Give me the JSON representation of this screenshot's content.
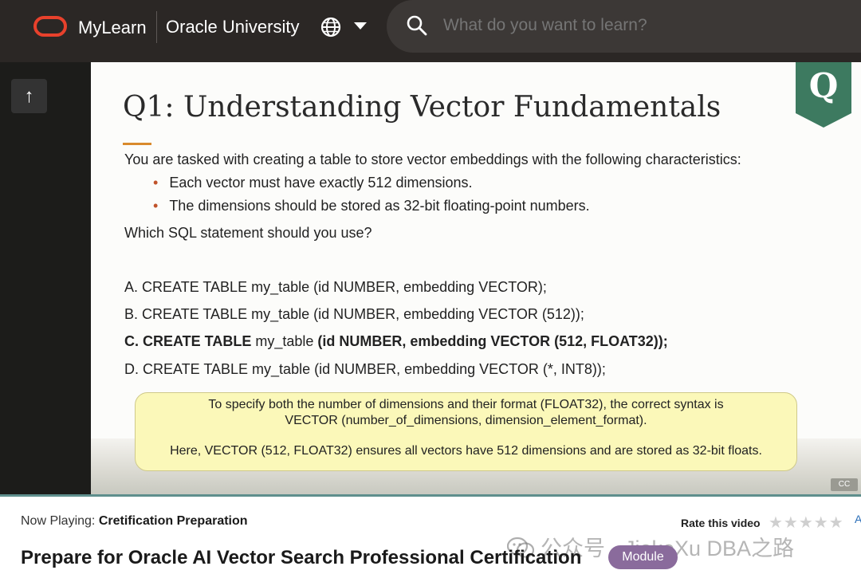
{
  "header": {
    "brand": "MyLearn",
    "org": "Oracle University",
    "search": {
      "placeholder": "What do you want to learn?"
    }
  },
  "rail": {
    "up_label": "↑"
  },
  "slide": {
    "badge": "Q",
    "title": "Q1: Understanding Vector Fundamentals",
    "intro": "You are tasked with creating a table to store vector embeddings with the following characteristics:",
    "bullets": [
      "Each vector must have exactly 512 dimensions.",
      "The dimensions should be stored as 32-bit floating-point numbers."
    ],
    "ask": "Which SQL statement should you use?",
    "options": {
      "a_letter": "A.",
      "a_text": "CREATE TABLE my_table (id NUMBER, embedding VECTOR);",
      "b_letter": "B.",
      "b_text": "CREATE TABLE my_table (id NUMBER, embedding VECTOR (512));",
      "c_letter": "C.",
      "c_part1": "CREATE TABLE",
      "c_part2": "my_table",
      "c_part3": "(id NUMBER, embedding VECTOR (512, FLOAT32));",
      "d_letter": "D.",
      "d_text": "CREATE TABLE my_table (id NUMBER, embedding VECTOR (*, INT8));"
    },
    "explanation": {
      "line1": "To specify both the number of dimensions and their format (FLOAT32), the correct syntax is",
      "line2": "VECTOR (number_of_dimensions, dimension_element_format).",
      "line3": "Here, VECTOR (512, FLOAT32) ensures all vectors have 512 dimensions and are stored as 32-bit floats."
    },
    "cc_label": "CC"
  },
  "footer": {
    "now_playing_label": "Now Playing:",
    "now_playing_value": "Cretification Preparation",
    "rate_label": "Rate this video",
    "stars": "★★★★★",
    "rating_value": 0,
    "cut_text": "A",
    "course_title": "Prepare for Oracle AI Vector Search Professional Certification",
    "module_badge": "Module",
    "watermark": "公众号 · JiekeXu DBA之路"
  },
  "colors": {
    "header_bg": "#2b2725",
    "oracle_red": "#e8412c",
    "badge_green": "#3d7a60",
    "callout_yellow": "#fbf8b9",
    "module_purple": "#8a6b9c"
  }
}
